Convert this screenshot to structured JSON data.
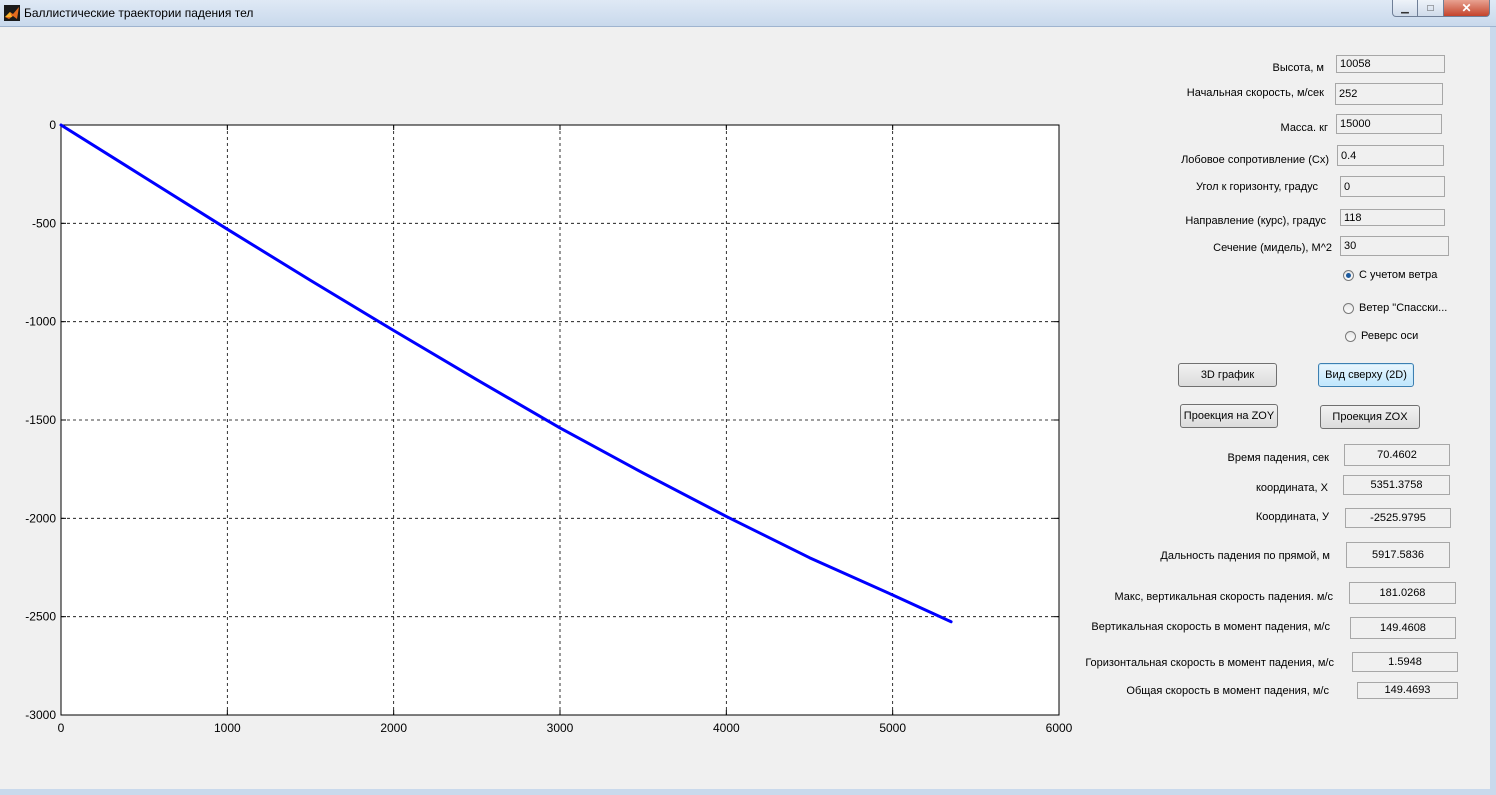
{
  "window": {
    "title": "Баллистические траектории падения тел"
  },
  "inputs": [
    {
      "label": "Высота, м",
      "value": "10058"
    },
    {
      "label": "Начальная скорость, м/сек",
      "value": "252"
    },
    {
      "label": "Масса. кг",
      "value": "15000"
    },
    {
      "label": "Лобовое сопротивление (Cx)",
      "value": "0.4"
    },
    {
      "label": "Угол к горизонту, градус",
      "value": "0"
    },
    {
      "label": "Направление  (курс), градус",
      "value": "118"
    },
    {
      "label": "Сечение (мидель), М^2",
      "value": "30"
    }
  ],
  "options": [
    {
      "label": "С учетом ветра",
      "checked": true
    },
    {
      "label": "Ветер \"Спасски...",
      "checked": false
    },
    {
      "label": "Реверс оси",
      "checked": false
    }
  ],
  "buttons": {
    "plot3d": "3D график",
    "top_view": "Вид сверху (2D)",
    "zoy": "Проекция на ZOY",
    "zox": "Проекция ZOX"
  },
  "results": [
    {
      "label": "Время падения, сек",
      "value": "70.4602"
    },
    {
      "label": "координата, Х",
      "value": "5351.3758"
    },
    {
      "label": "Координата, У",
      "value": "-2525.9795"
    },
    {
      "label": "Дальность падения по прямой, м",
      "value": "5917.5836"
    },
    {
      "label": "Макс,  вертикальная скорость падения. м/с",
      "value": "181.0268"
    },
    {
      "label": "Вертикальная  скорость в момент падения, м/с",
      "value": "149.4608"
    },
    {
      "label": "Горизонтальная скорость в момент падения, м/с",
      "value": "1.5948"
    },
    {
      "label": "Общая скорость в момент падения, м/с",
      "value": "149.4693"
    }
  ],
  "chart_data": {
    "type": "line",
    "x_ticks": [
      0,
      1000,
      2000,
      3000,
      4000,
      5000,
      6000
    ],
    "y_ticks": [
      0,
      -500,
      -1000,
      -1500,
      -2000,
      -2500,
      -3000
    ],
    "xlim": [
      0,
      6000
    ],
    "ylim": [
      -3000,
      0
    ],
    "grid": true,
    "series": [
      {
        "color": "#0000ff",
        "x": [
          0,
          500,
          1000,
          1500,
          2000,
          2500,
          3000,
          3500,
          4000,
          4500,
          5000,
          5351.3758
        ],
        "y": [
          0,
          -265,
          -530,
          -790,
          -1045,
          -1295,
          -1540,
          -1770,
          -1990,
          -2200,
          -2390,
          -2525.9795
        ]
      }
    ]
  }
}
